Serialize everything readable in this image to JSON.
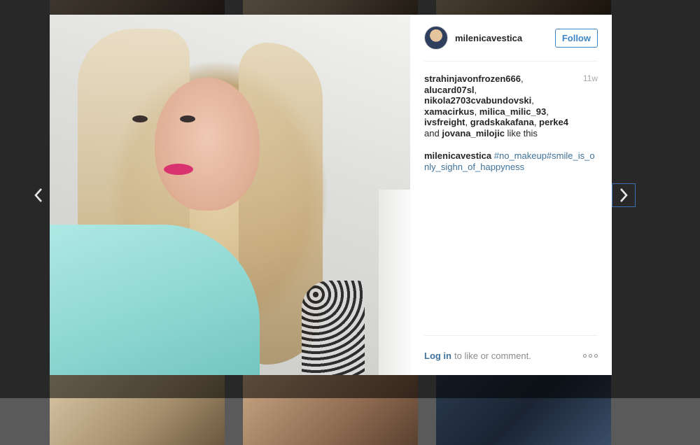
{
  "post": {
    "username": "milenicavestica",
    "follow_label": "Follow",
    "time": "11w",
    "likers": [
      "strahinjavonfrozen666",
      "alucard07sl",
      "nikola2703cvabundovski",
      "xamacirkus",
      "milica_milic_93",
      "ivsfreight",
      "gradskakafana",
      "perke4",
      "jovana_milojic"
    ],
    "likes_and": "and",
    "likes_suffix": "like this",
    "caption_user": "milenicavestica",
    "caption_tags": "#no_makeup#smile_is_only_sighn_of_happyness"
  },
  "footer": {
    "login_label": "Log in",
    "login_rest": "to like or comment."
  },
  "icons": {
    "prev": "chevron-left-icon",
    "next": "chevron-right-icon",
    "more": "more-options-icon"
  }
}
